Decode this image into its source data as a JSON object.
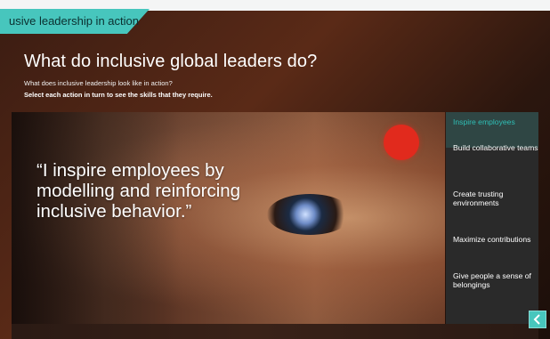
{
  "module": {
    "tab_label": "usive leadership in action"
  },
  "header": {
    "title": "What do inclusive global leaders do?",
    "subtitle": "What does inclusive leadership look like in action?",
    "instruction": "Select each action in turn to see the skills that they require."
  },
  "quote": {
    "text": "“I inspire employees by modelling and reinforcing inclusive behavior.”"
  },
  "menu": {
    "items": [
      {
        "label": "Inspire employees",
        "active": true
      },
      {
        "label": "Build collaborative teams",
        "active": false
      },
      {
        "label": "Create trusting environments",
        "active": false
      },
      {
        "label": "Maximize contributions",
        "active": false
      },
      {
        "label": "Give people a sense of belongings",
        "active": false
      }
    ]
  },
  "colors": {
    "accent": "#47C6BD",
    "bindi": "#E12A1D"
  },
  "icons": {
    "back": "chevron-left-icon"
  }
}
